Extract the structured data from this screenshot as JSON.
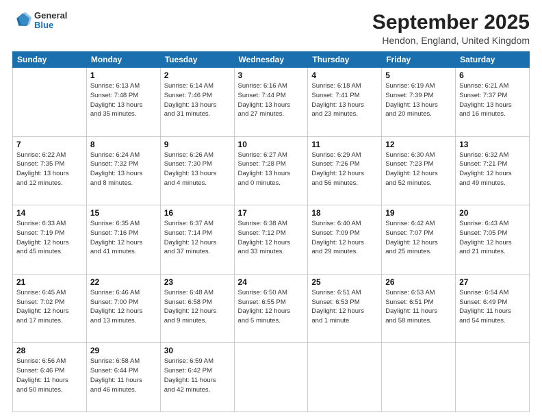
{
  "header": {
    "logo_line1": "General",
    "logo_line2": "Blue",
    "title": "September 2025",
    "subtitle": "Hendon, England, United Kingdom"
  },
  "columns": [
    "Sunday",
    "Monday",
    "Tuesday",
    "Wednesday",
    "Thursday",
    "Friday",
    "Saturday"
  ],
  "weeks": [
    [
      {
        "day": "",
        "info": ""
      },
      {
        "day": "1",
        "info": "Sunrise: 6:13 AM\nSunset: 7:48 PM\nDaylight: 13 hours\nand 35 minutes."
      },
      {
        "day": "2",
        "info": "Sunrise: 6:14 AM\nSunset: 7:46 PM\nDaylight: 13 hours\nand 31 minutes."
      },
      {
        "day": "3",
        "info": "Sunrise: 6:16 AM\nSunset: 7:44 PM\nDaylight: 13 hours\nand 27 minutes."
      },
      {
        "day": "4",
        "info": "Sunrise: 6:18 AM\nSunset: 7:41 PM\nDaylight: 13 hours\nand 23 minutes."
      },
      {
        "day": "5",
        "info": "Sunrise: 6:19 AM\nSunset: 7:39 PM\nDaylight: 13 hours\nand 20 minutes."
      },
      {
        "day": "6",
        "info": "Sunrise: 6:21 AM\nSunset: 7:37 PM\nDaylight: 13 hours\nand 16 minutes."
      }
    ],
    [
      {
        "day": "7",
        "info": "Sunrise: 6:22 AM\nSunset: 7:35 PM\nDaylight: 13 hours\nand 12 minutes."
      },
      {
        "day": "8",
        "info": "Sunrise: 6:24 AM\nSunset: 7:32 PM\nDaylight: 13 hours\nand 8 minutes."
      },
      {
        "day": "9",
        "info": "Sunrise: 6:26 AM\nSunset: 7:30 PM\nDaylight: 13 hours\nand 4 minutes."
      },
      {
        "day": "10",
        "info": "Sunrise: 6:27 AM\nSunset: 7:28 PM\nDaylight: 13 hours\nand 0 minutes."
      },
      {
        "day": "11",
        "info": "Sunrise: 6:29 AM\nSunset: 7:26 PM\nDaylight: 12 hours\nand 56 minutes."
      },
      {
        "day": "12",
        "info": "Sunrise: 6:30 AM\nSunset: 7:23 PM\nDaylight: 12 hours\nand 52 minutes."
      },
      {
        "day": "13",
        "info": "Sunrise: 6:32 AM\nSunset: 7:21 PM\nDaylight: 12 hours\nand 49 minutes."
      }
    ],
    [
      {
        "day": "14",
        "info": "Sunrise: 6:33 AM\nSunset: 7:19 PM\nDaylight: 12 hours\nand 45 minutes."
      },
      {
        "day": "15",
        "info": "Sunrise: 6:35 AM\nSunset: 7:16 PM\nDaylight: 12 hours\nand 41 minutes."
      },
      {
        "day": "16",
        "info": "Sunrise: 6:37 AM\nSunset: 7:14 PM\nDaylight: 12 hours\nand 37 minutes."
      },
      {
        "day": "17",
        "info": "Sunrise: 6:38 AM\nSunset: 7:12 PM\nDaylight: 12 hours\nand 33 minutes."
      },
      {
        "day": "18",
        "info": "Sunrise: 6:40 AM\nSunset: 7:09 PM\nDaylight: 12 hours\nand 29 minutes."
      },
      {
        "day": "19",
        "info": "Sunrise: 6:42 AM\nSunset: 7:07 PM\nDaylight: 12 hours\nand 25 minutes."
      },
      {
        "day": "20",
        "info": "Sunrise: 6:43 AM\nSunset: 7:05 PM\nDaylight: 12 hours\nand 21 minutes."
      }
    ],
    [
      {
        "day": "21",
        "info": "Sunrise: 6:45 AM\nSunset: 7:02 PM\nDaylight: 12 hours\nand 17 minutes."
      },
      {
        "day": "22",
        "info": "Sunrise: 6:46 AM\nSunset: 7:00 PM\nDaylight: 12 hours\nand 13 minutes."
      },
      {
        "day": "23",
        "info": "Sunrise: 6:48 AM\nSunset: 6:58 PM\nDaylight: 12 hours\nand 9 minutes."
      },
      {
        "day": "24",
        "info": "Sunrise: 6:50 AM\nSunset: 6:55 PM\nDaylight: 12 hours\nand 5 minutes."
      },
      {
        "day": "25",
        "info": "Sunrise: 6:51 AM\nSunset: 6:53 PM\nDaylight: 12 hours\nand 1 minute."
      },
      {
        "day": "26",
        "info": "Sunrise: 6:53 AM\nSunset: 6:51 PM\nDaylight: 11 hours\nand 58 minutes."
      },
      {
        "day": "27",
        "info": "Sunrise: 6:54 AM\nSunset: 6:49 PM\nDaylight: 11 hours\nand 54 minutes."
      }
    ],
    [
      {
        "day": "28",
        "info": "Sunrise: 6:56 AM\nSunset: 6:46 PM\nDaylight: 11 hours\nand 50 minutes."
      },
      {
        "day": "29",
        "info": "Sunrise: 6:58 AM\nSunset: 6:44 PM\nDaylight: 11 hours\nand 46 minutes."
      },
      {
        "day": "30",
        "info": "Sunrise: 6:59 AM\nSunset: 6:42 PM\nDaylight: 11 hours\nand 42 minutes."
      },
      {
        "day": "",
        "info": ""
      },
      {
        "day": "",
        "info": ""
      },
      {
        "day": "",
        "info": ""
      },
      {
        "day": "",
        "info": ""
      }
    ]
  ]
}
